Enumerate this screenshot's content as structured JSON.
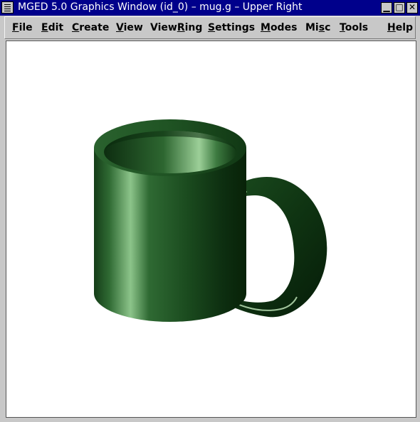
{
  "window": {
    "title": "MGED 5.0 Graphics Window (id_0) – mug.g – Upper Right",
    "minimize_glyph": "▁",
    "maximize_glyph": "□",
    "close_glyph": "✕"
  },
  "menu": {
    "file": {
      "u": "F",
      "rest": "ile"
    },
    "edit": {
      "u": "E",
      "rest": "dit"
    },
    "create": {
      "u": "C",
      "rest": "reate"
    },
    "view": {
      "u": "V",
      "rest": "iew"
    },
    "viewring": {
      "pre": "View",
      "u": "R",
      "rest": "ing"
    },
    "settings": {
      "u": "S",
      "rest": "ettings"
    },
    "modes": {
      "u": "M",
      "rest": "odes"
    },
    "misc": {
      "pre": "Mi",
      "u": "s",
      "rest": "c"
    },
    "tools": {
      "u": "T",
      "rest": "ools"
    },
    "help": {
      "u": "H",
      "rest": "elp"
    }
  },
  "scene": {
    "object": "mug",
    "color": "#1f5a24",
    "highlight": "#a8d8a0",
    "background": "#ffffff"
  }
}
